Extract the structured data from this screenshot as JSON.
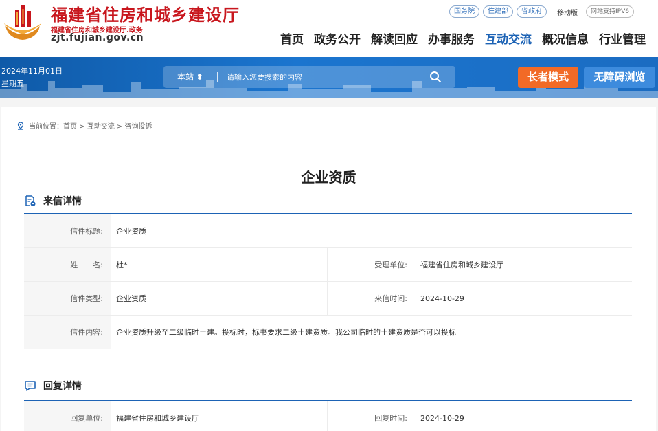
{
  "header": {
    "title": "福建省住房和城乡建设厅",
    "subtitle": "福建省住房和城乡建设厅.政务",
    "url": "zjt.fujian.gov.cn",
    "top_links": [
      "国务院",
      "住建部",
      "省政府"
    ],
    "mobile_label": "移动版",
    "ipv6_label": "网站支持IPV6",
    "nav": [
      "首页",
      "政务公开",
      "解读回应",
      "办事服务",
      "互动交流",
      "概况信息",
      "行业管理"
    ],
    "active_nav": "互动交流"
  },
  "banner": {
    "date": "2024年11月01日",
    "weekday": "星期五",
    "search_scope": "本站 ⬍",
    "search_placeholder": "请输入您要搜索的内容",
    "elder_mode_label": "长者模式",
    "accessible_label": "无障碍浏览"
  },
  "breadcrumb": {
    "text": "当前位置：首页 > 互动交流 > 咨询投诉"
  },
  "page_title": "企业资质",
  "letter": {
    "section_title": "来信详情",
    "subject_label": "信件标题:",
    "subject": "企业资质",
    "name_label": "姓　　名:",
    "name": "杜*",
    "unit_label": "受理单位:",
    "unit": "福建省住房和城乡建设厅",
    "type_label": "信件类型:",
    "type": "企业资质",
    "time_label": "来信时间:",
    "time": "2024-10-29",
    "content_label": "信件内容:",
    "content": "企业资质升级至二级临时土建。投标时，标书要求二级土建资质。我公司临时的土建资质是否可以投标"
  },
  "reply": {
    "section_title": "回复详情",
    "unit_label": "回复单位:",
    "unit": "福建省住房和城乡建设厅",
    "time_label": "回复时间:",
    "time": "2024-10-29"
  },
  "colors": {
    "brand_red": "#c8161d",
    "nav_active": "#1d63b5",
    "banner_blue": "#1b6cc2",
    "elder_orange": "#f26a26",
    "accessible_blue": "#3d8bdd"
  }
}
